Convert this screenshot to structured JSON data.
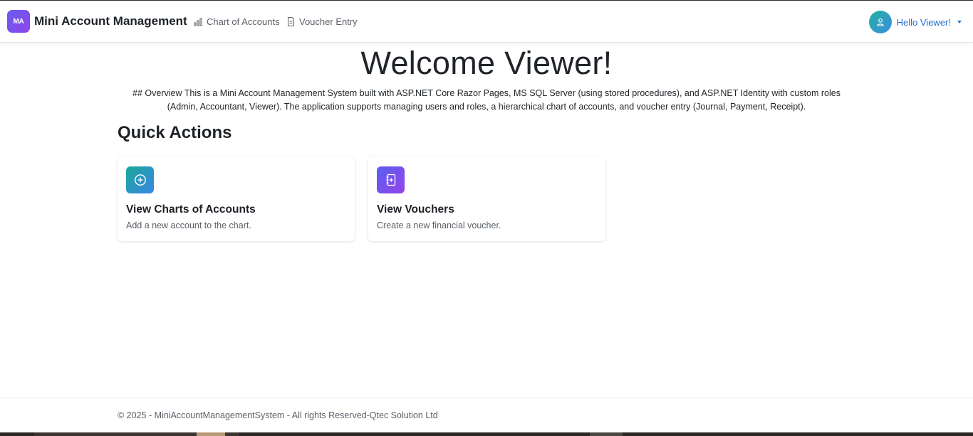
{
  "navbar": {
    "brand_logo": "MA",
    "brand_name": "Mini Account Management",
    "links": [
      {
        "label": "Chart of Accounts",
        "icon": "bar-chart-icon"
      },
      {
        "label": "Voucher Entry",
        "icon": "document-icon"
      }
    ],
    "user_label": "Hello Viewer!"
  },
  "main": {
    "welcome": "Welcome Viewer!",
    "overview": "## Overview This is a Mini Account Management System built with ASP.NET Core Razor Pages, MS SQL Server (using stored procedures), and ASP.NET Identity with custom roles (Admin, Accountant, Viewer). The application supports managing users and roles, a hierarchical chart of accounts, and voucher entry (Journal, Payment, Receipt).",
    "section_title": "Quick Actions",
    "cards": [
      {
        "title": "View Charts of Accounts",
        "description": "Add a new account to the chart.",
        "icon": "plus-circle-icon"
      },
      {
        "title": "View Vouchers",
        "description": "Create a new financial voucher.",
        "icon": "journal-plus-icon"
      }
    ]
  },
  "footer": {
    "text": "© 2025 - MiniAccountManagementSystem - All rights Reserved-Qtec Solution Ltd"
  },
  "colors": {
    "accent_link": "#1f6fd0",
    "brand_gradient": [
      "#6a5cf0",
      "#8e44ec"
    ],
    "teal_gradient": [
      "#1aa89a",
      "#3a86e4"
    ]
  }
}
